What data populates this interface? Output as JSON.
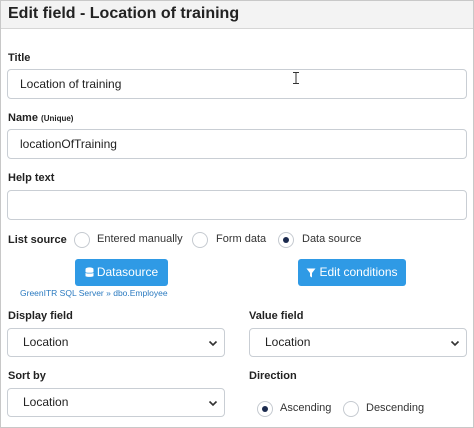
{
  "dialog": {
    "title": "Edit field - Location of training"
  },
  "title_field": {
    "label": "Title",
    "value": "Location of training"
  },
  "name_field": {
    "label": "Name",
    "hint": "(Unique)",
    "value": "locationOfTraining"
  },
  "help_text": {
    "label": "Help text",
    "value": ""
  },
  "list_source": {
    "label": "List source",
    "options": [
      {
        "label": "Entered manually",
        "checked": false
      },
      {
        "label": "Form data",
        "checked": false
      },
      {
        "label": "Data source",
        "checked": true
      }
    ]
  },
  "buttons": {
    "datasource_label": "Datasource",
    "edit_conditions_label": "Edit conditions"
  },
  "datasource_link": "GreenITR SQL Server » dbo.Employee",
  "display_field": {
    "label": "Display field",
    "value": "Location"
  },
  "value_field": {
    "label": "Value field",
    "value": "Location"
  },
  "sort_by": {
    "label": "Sort by",
    "value": "Location"
  },
  "direction": {
    "label": "Direction",
    "options": [
      {
        "label": "Ascending",
        "checked": true
      },
      {
        "label": "Descending",
        "checked": false
      }
    ]
  },
  "icons": {
    "datasource": "database-icon",
    "edit_conditions": "filter-icon",
    "select": "chevron-down-icon",
    "cursor": "text-cursor-icon"
  },
  "colors": {
    "accent": "#2f9ae5",
    "link": "#2a7ac0",
    "radio_checked": "#1b2a4e"
  }
}
